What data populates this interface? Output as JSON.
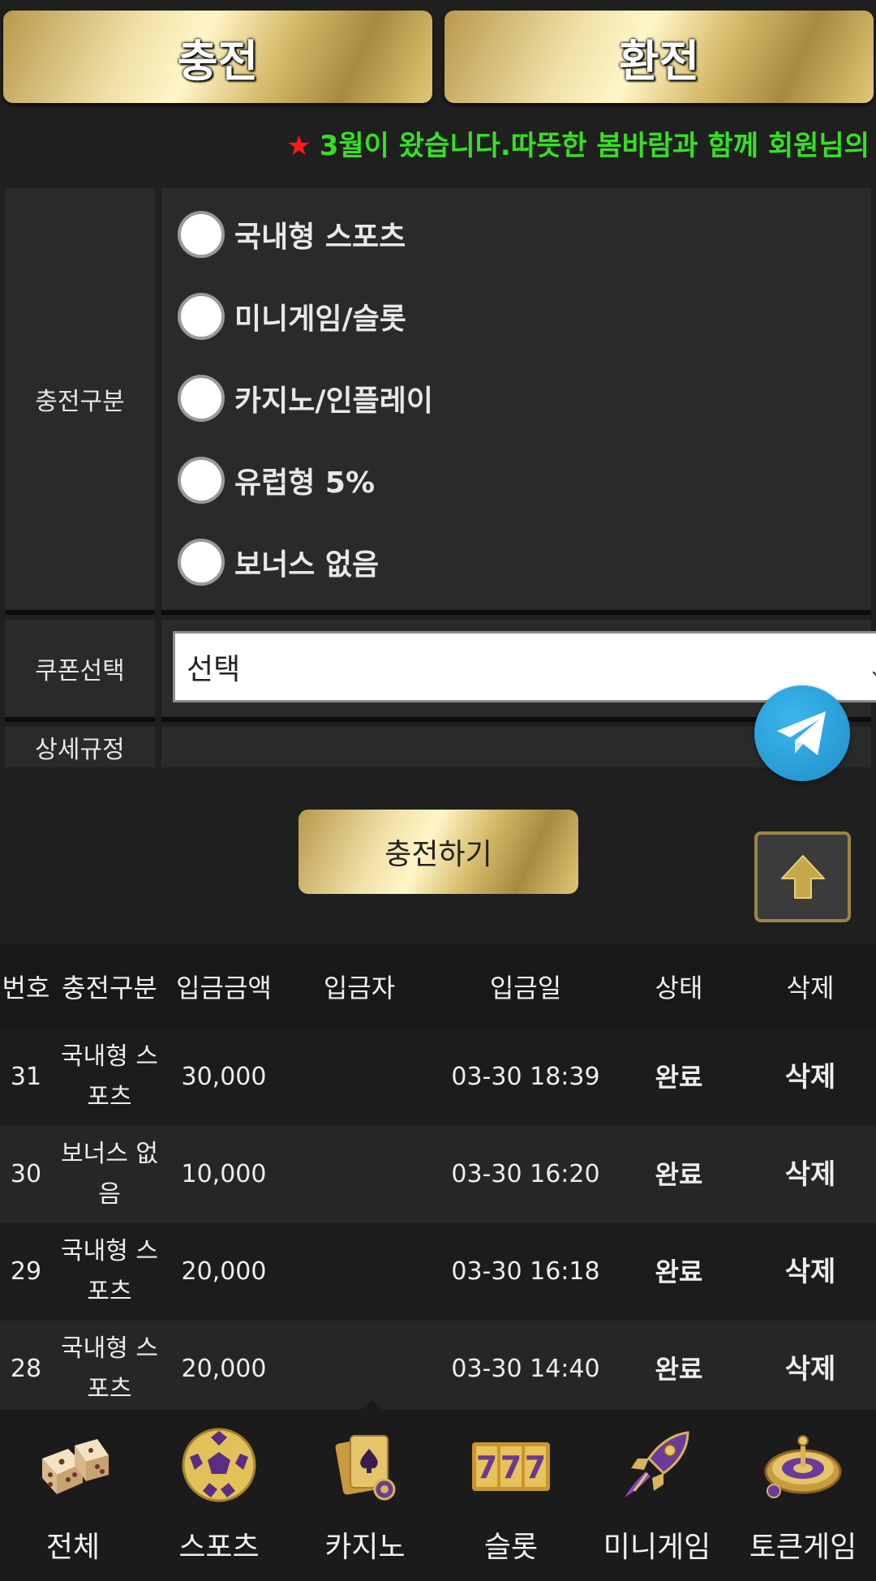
{
  "tabs": {
    "charge": "충전",
    "exchange": "환전"
  },
  "notice": {
    "star": "★",
    "text": "3월이 왔습니다.따뜻한 봄바람과 함께 회원님의"
  },
  "form": {
    "type_label": "충전구분",
    "options": [
      "국내형 스포츠",
      "미니게임/슬롯",
      "카지노/인플레이",
      "유럽형 5%",
      "보너스 없음"
    ],
    "coupon_label": "쿠폰선택",
    "coupon_value": "선택",
    "rules_label": "상세규정",
    "submit_label": "충전하기"
  },
  "table": {
    "headers": [
      "번호",
      "충전구분",
      "입금금액",
      "입금자",
      "입금일",
      "상태",
      "삭제"
    ],
    "rows": [
      {
        "no": "31",
        "type_l1": "국내형 스",
        "type_l2": "포츠",
        "amount": "30,000",
        "depositor": "",
        "date": "03-30 18:39",
        "status": "완료",
        "delete": "삭제"
      },
      {
        "no": "30",
        "type_l1": "보너스 없",
        "type_l2": "음",
        "amount": "10,000",
        "depositor": "",
        "date": "03-30 16:20",
        "status": "완료",
        "delete": "삭제"
      },
      {
        "no": "29",
        "type_l1": "국내형 스",
        "type_l2": "포츠",
        "amount": "20,000",
        "depositor": "",
        "date": "03-30 16:18",
        "status": "완료",
        "delete": "삭제"
      },
      {
        "no": "28",
        "type_l1": "국내형 스",
        "type_l2": "포츠",
        "amount": "20,000",
        "depositor": "",
        "date": "03-30 14:40",
        "status": "완료",
        "delete": "삭제"
      }
    ]
  },
  "bottom_nav": [
    {
      "label": "전체",
      "icon": "dice-icon"
    },
    {
      "label": "스포츠",
      "icon": "soccer-ball-icon"
    },
    {
      "label": "카지노",
      "icon": "playing-cards-icon"
    },
    {
      "label": "슬롯",
      "icon": "slot-777-icon"
    },
    {
      "label": "미니게임",
      "icon": "rocket-icon"
    },
    {
      "label": "토큰게임",
      "icon": "roulette-icon"
    }
  ],
  "colors": {
    "gold": "#e0c878",
    "notice_green": "#37e023",
    "star_red": "#ff1a1a",
    "telegram_blue": "#2a9fd8"
  }
}
